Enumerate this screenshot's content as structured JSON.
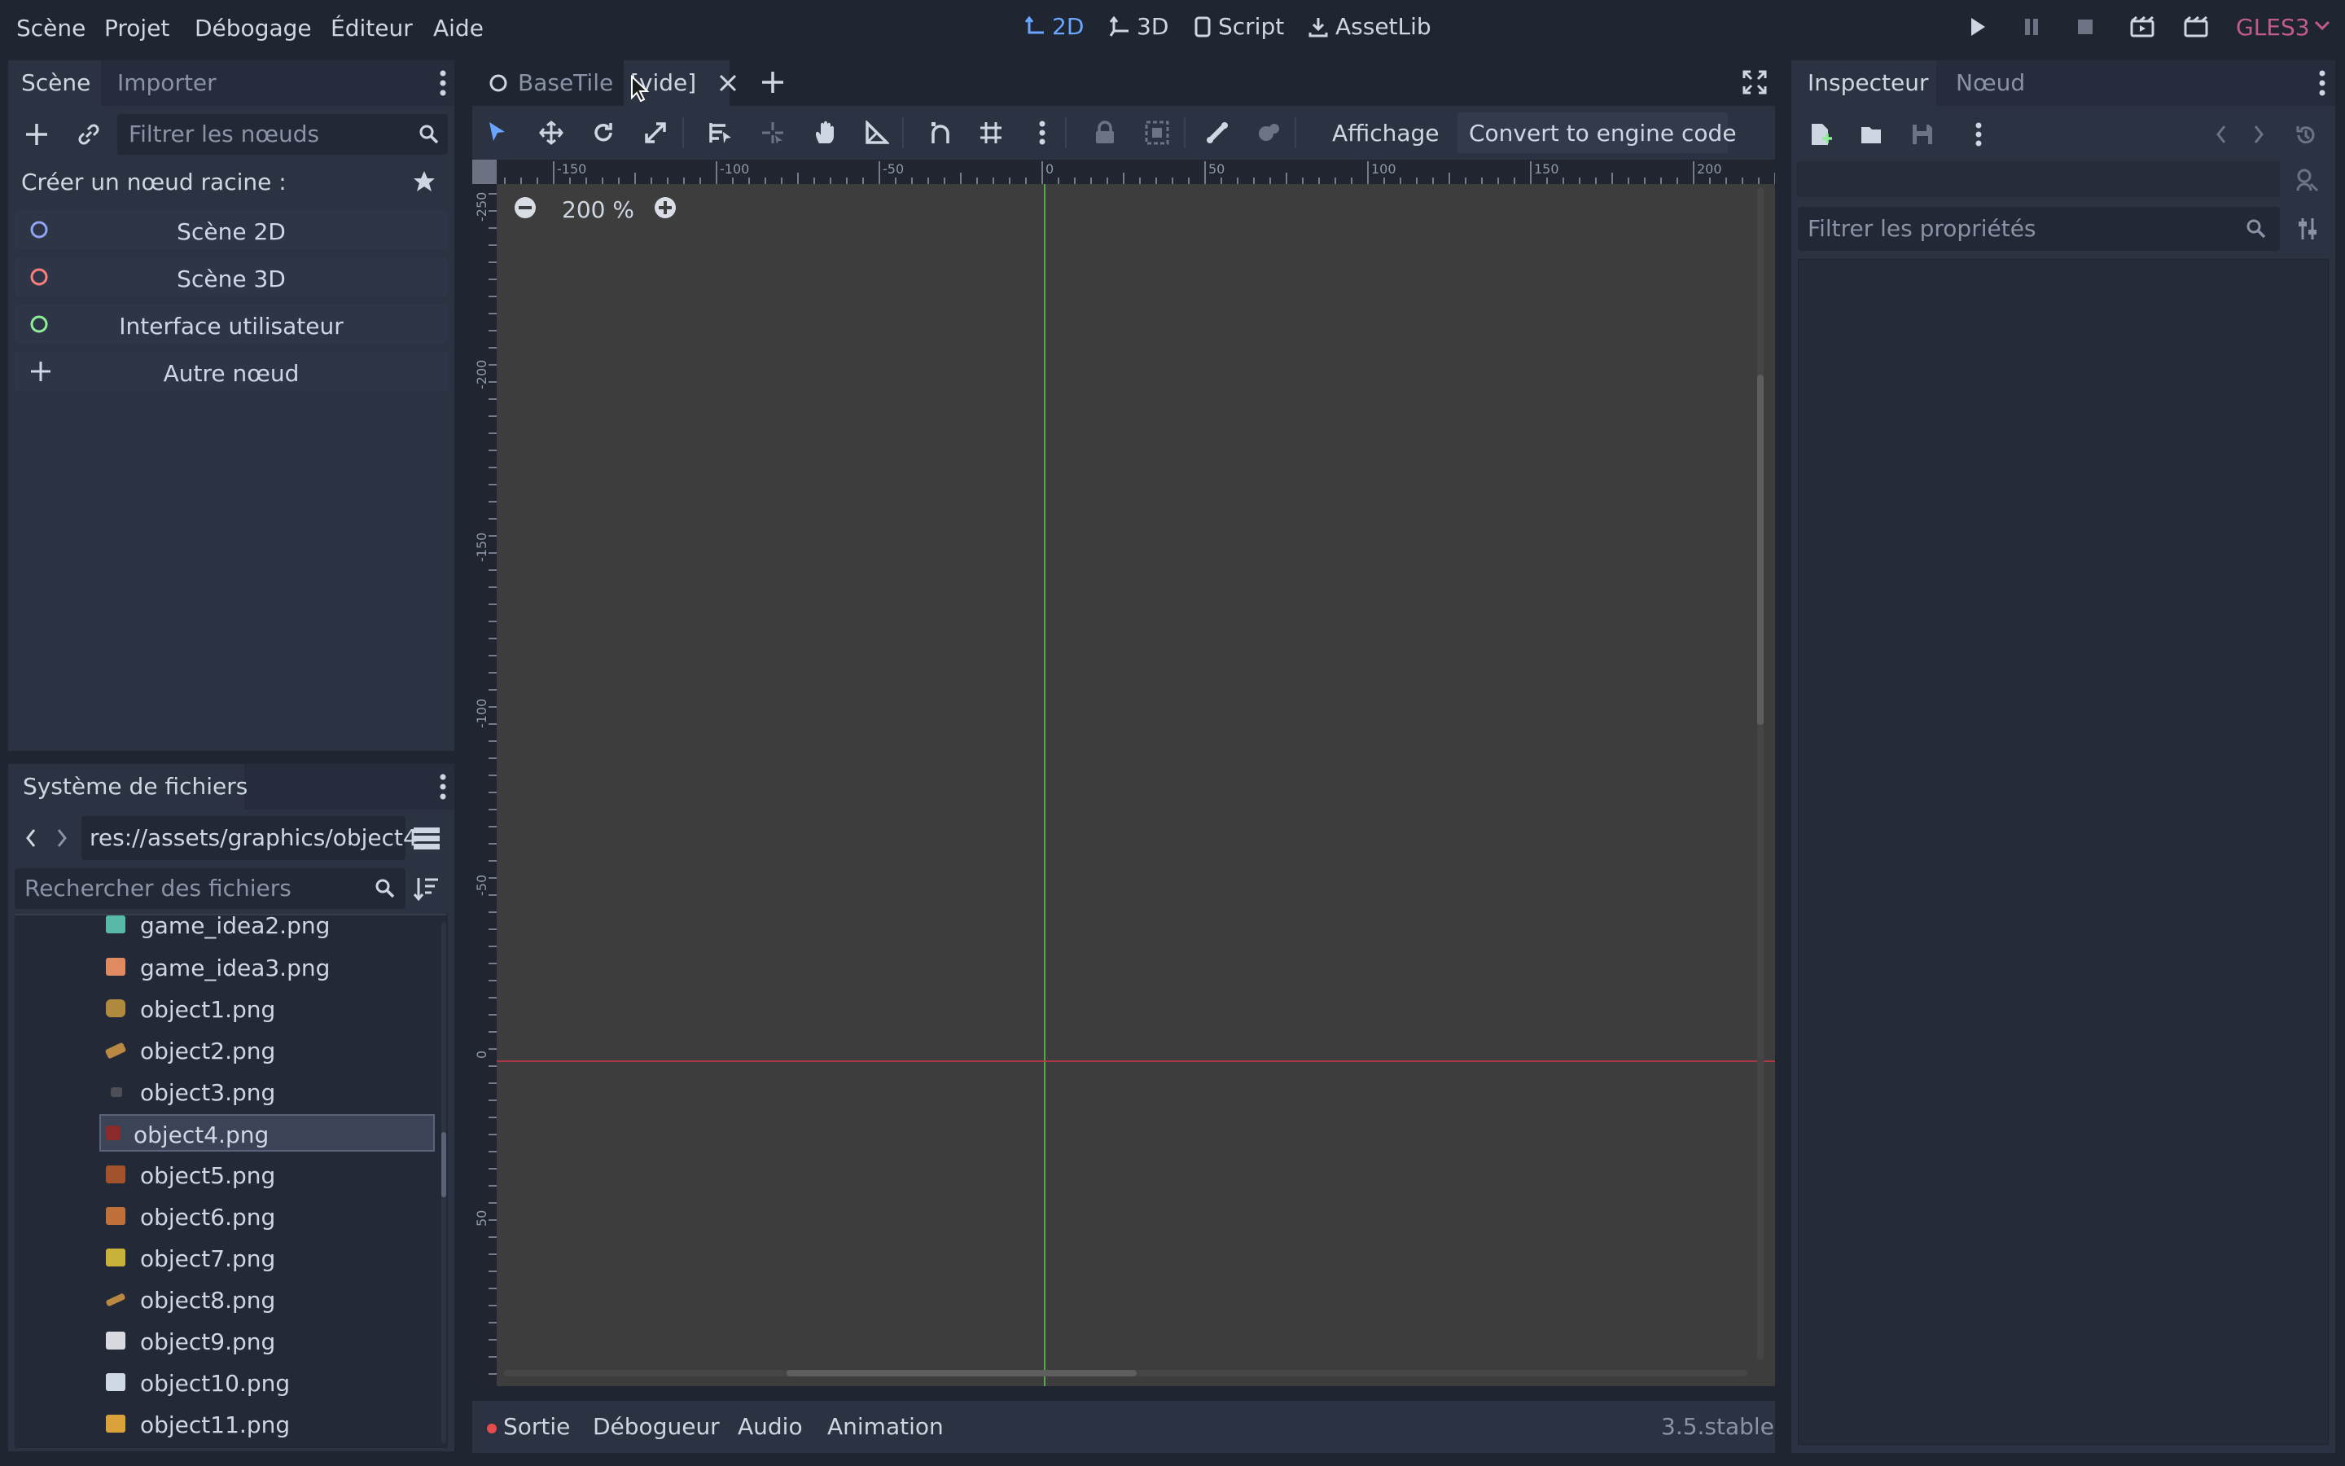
{
  "menu": {
    "items": [
      "Scène",
      "Projet",
      "Débogage",
      "Éditeur",
      "Aide"
    ]
  },
  "modes": {
    "m2d": "2D",
    "m3d": "3D",
    "script": "Script",
    "assetlib": "AssetLib"
  },
  "renderer": "GLES3",
  "scene_panel": {
    "tab_scene": "Scène",
    "tab_import": "Importer",
    "filter_placeholder": "Filtrer les nœuds",
    "create_root": "Créer un nœud racine :",
    "buttons": [
      "Scène 2D",
      "Scène 3D",
      "Interface utilisateur",
      "Autre nœud"
    ]
  },
  "filesystem": {
    "title": "Système de fichiers",
    "path": "res://assets/graphics/object4",
    "search_placeholder": "Rechercher des fichiers",
    "files": [
      "game_idea2.png",
      "game_idea3.png",
      "object1.png",
      "object2.png",
      "object3.png",
      "object4.png",
      "object5.png",
      "object6.png",
      "object7.png",
      "object8.png",
      "object9.png",
      "object10.png",
      "object11.png"
    ],
    "selected": "object4.png"
  },
  "editor_tabs": {
    "tab1": "BaseTile",
    "tab2": "[vide]"
  },
  "toolbar": {
    "view": "Affichage",
    "convert": "Convert to engine code"
  },
  "viewport": {
    "zoom": "200 %",
    "hruler": [
      "-150",
      "-100",
      "-50",
      "0",
      "50",
      "100",
      "150",
      "200"
    ],
    "vruler": [
      "-250",
      "-200",
      "-150",
      "-100",
      "-50",
      "0",
      "50"
    ]
  },
  "bottom": {
    "tabs": [
      "Sortie",
      "Débogueur",
      "Audio",
      "Animation"
    ],
    "version": "3.5.stable"
  },
  "inspector": {
    "tab_inspector": "Inspecteur",
    "tab_node": "Nœud",
    "filter_placeholder": "Filtrer les propriétés"
  },
  "colors": {
    "accent": "#6aa6ff",
    "axis_x": "#c9364a",
    "axis_y": "#5bc24e",
    "renderer": "#c05c8a"
  }
}
